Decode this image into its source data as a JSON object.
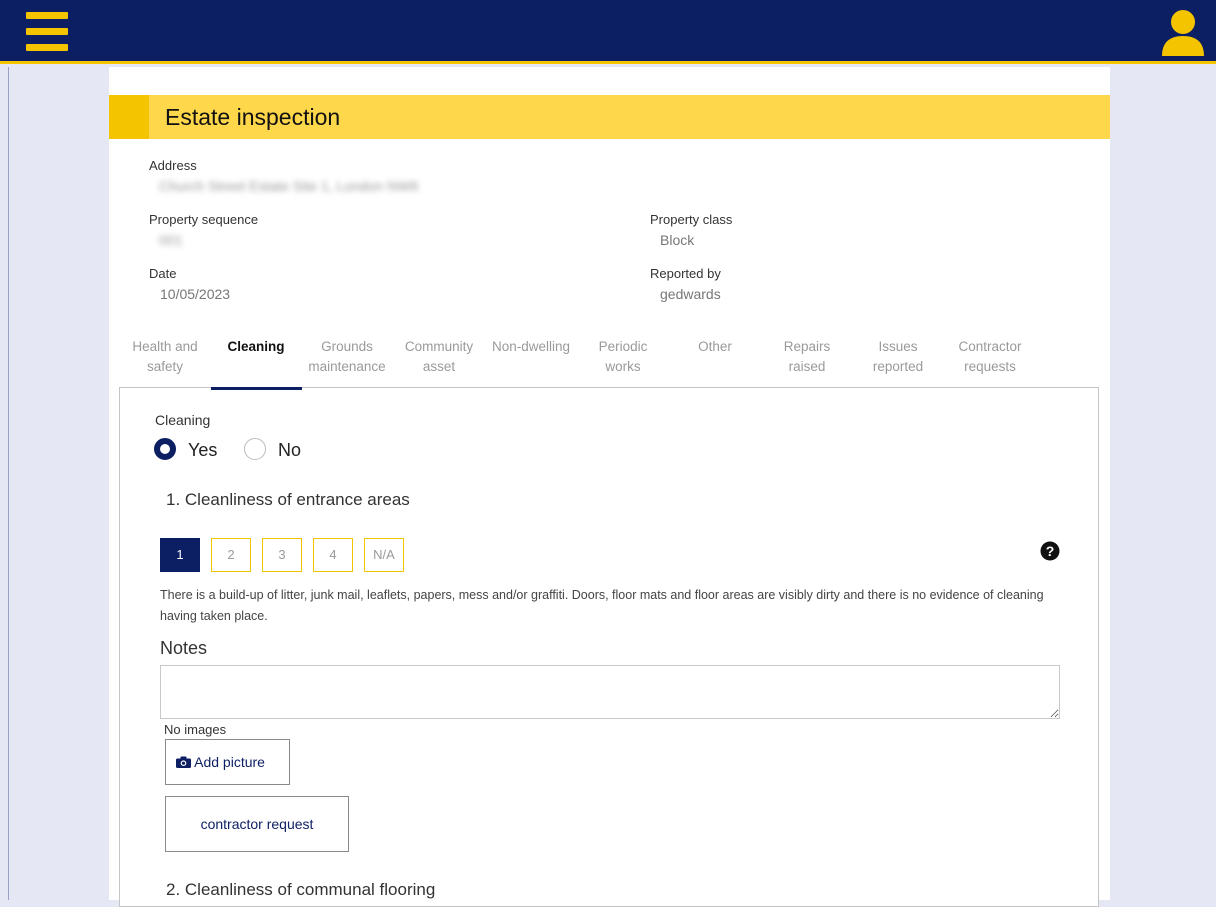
{
  "page": {
    "title": "Estate inspection"
  },
  "colors": {
    "navy": "#0c1f63",
    "yellow": "#f5c400",
    "title_bg": "#fed74a",
    "page_bg": "#e6e7f5"
  },
  "icons": {
    "menu": "hamburger-menu-icon",
    "user": "user-icon",
    "help": "question-circle-icon",
    "camera": "camera-icon"
  },
  "details": {
    "address_label": "Address",
    "address_value": "Church Street Estate Site 1, London NW8",
    "sequence_label": "Property sequence",
    "sequence_value": "001",
    "class_label": "Property class",
    "class_value": "Block",
    "date_label": "Date",
    "date_value": "10/05/2023",
    "reported_label": "Reported by",
    "reported_value": "gedwards"
  },
  "tabs": [
    {
      "l1": "Health and",
      "l2": "safety"
    },
    {
      "l1": "Cleaning",
      "l2": ""
    },
    {
      "l1": "Grounds",
      "l2": "maintenance"
    },
    {
      "l1": "Community",
      "l2": "asset"
    },
    {
      "l1": "Non-dwelling",
      "l2": ""
    },
    {
      "l1": "Periodic",
      "l2": "works"
    },
    {
      "l1": "Other",
      "l2": ""
    },
    {
      "l1": "Repairs",
      "l2": "raised"
    },
    {
      "l1": "Issues",
      "l2": "reported"
    },
    {
      "l1": "Contractor",
      "l2": "requests"
    }
  ],
  "active_tab": "Cleaning",
  "cleaning": {
    "section_label": "Cleaning",
    "yes_label": "Yes",
    "no_label": "No",
    "selected": "Yes",
    "question1": "1. Cleanliness of entrance areas",
    "scores": [
      "1",
      "2",
      "3",
      "4",
      "N/A"
    ],
    "selected_score": "1",
    "description": "There is a build-up of litter, junk mail, leaflets, papers, mess and/or graffiti. Doors, floor mats and floor areas are visibly dirty and there is no evidence of cleaning having taken place.",
    "notes_label": "Notes",
    "notes_value": "",
    "no_images": "No images",
    "add_picture": "Add picture",
    "contractor_request": "contractor request",
    "question2": "2. Cleanliness of communal flooring"
  }
}
